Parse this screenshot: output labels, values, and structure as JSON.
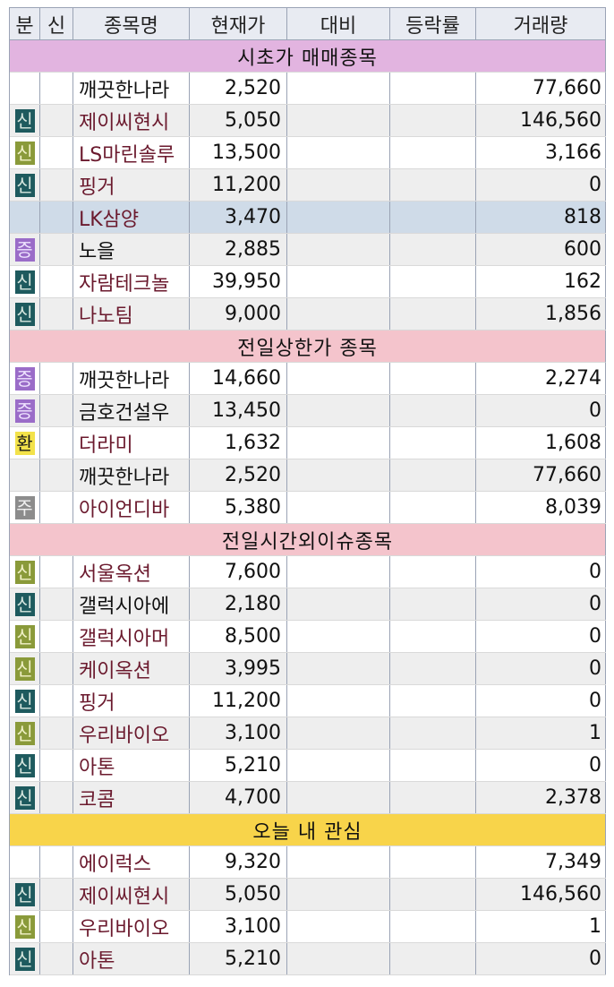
{
  "columns": [
    "분",
    "신",
    "종목명",
    "현재가",
    "대비",
    "등락률",
    "거래량"
  ],
  "badge_styles": {
    "신a": {
      "bg": "#1e5a5e",
      "fg": "#d8e8e0"
    },
    "신b": {
      "bg": "#8a9a3a",
      "fg": "#f2f2c8"
    },
    "증": {
      "bg": "#9a6cc8",
      "fg": "#efe4ff"
    },
    "환": {
      "bg": "#f3e24a",
      "fg": "#1a1a1a"
    },
    "주": {
      "bg": "#8c8c8c",
      "fg": "#f0f0f0"
    }
  },
  "sections": [
    {
      "title": "시초가 매매종목",
      "color": "#e2b4e0",
      "rows": [
        {
          "cat": "",
          "name": "깨끗한나라",
          "name_color": "black",
          "price": "2,520",
          "vol": "77,660"
        },
        {
          "cat": "신",
          "cat_style": "신a",
          "name": "제이씨현시",
          "name_color": "dark",
          "price": "5,050",
          "vol": "146,560"
        },
        {
          "cat": "신",
          "cat_style": "신b",
          "name": "LS마린솔루",
          "name_color": "dark",
          "price": "13,500",
          "vol": "3,166"
        },
        {
          "cat": "신",
          "cat_style": "신a",
          "name": "핑거",
          "name_color": "dark",
          "price": "11,200",
          "vol": "0"
        },
        {
          "cat": "",
          "name": "LK삼양",
          "name_color": "dark",
          "price": "3,470",
          "vol": "818",
          "selected": true
        },
        {
          "cat": "증",
          "cat_style": "증",
          "name": "노을",
          "name_color": "black",
          "price": "2,885",
          "vol": "600"
        },
        {
          "cat": "신",
          "cat_style": "신a",
          "name": "자람테크놀",
          "name_color": "dark",
          "price": "39,950",
          "vol": "162"
        },
        {
          "cat": "신",
          "cat_style": "신a",
          "name": "나노팀",
          "name_color": "dark",
          "price": "9,000",
          "vol": "1,856"
        }
      ]
    },
    {
      "title": "전일상한가 종목",
      "color": "#f4c4cc",
      "rows": [
        {
          "cat": "증",
          "cat_style": "증",
          "name": "깨끗한나라",
          "name_color": "black",
          "price": "14,660",
          "vol": "2,274"
        },
        {
          "cat": "증",
          "cat_style": "증",
          "name": "금호건설우",
          "name_color": "black",
          "price": "13,450",
          "vol": "0"
        },
        {
          "cat": "환",
          "cat_style": "환",
          "name": "더라미",
          "name_color": "dark",
          "price": "1,632",
          "vol": "1,608"
        },
        {
          "cat": "",
          "name": "깨끗한나라",
          "name_color": "black",
          "price": "2,520",
          "vol": "77,660"
        },
        {
          "cat": "주",
          "cat_style": "주",
          "name": "아이언디바",
          "name_color": "dark",
          "price": "5,380",
          "vol": "8,039"
        }
      ]
    },
    {
      "title": "전일시간외이슈종목",
      "color": "#f4c4cc",
      "rows": [
        {
          "cat": "신",
          "cat_style": "신b",
          "name": "서울옥션",
          "name_color": "dark",
          "price": "7,600",
          "vol": "0"
        },
        {
          "cat": "신",
          "cat_style": "신a",
          "name": "갤럭시아에",
          "name_color": "black",
          "price": "2,180",
          "vol": "0"
        },
        {
          "cat": "신",
          "cat_style": "신b",
          "name": "갤럭시아머",
          "name_color": "dark",
          "price": "8,500",
          "vol": "0"
        },
        {
          "cat": "신",
          "cat_style": "신b",
          "name": "케이옥션",
          "name_color": "dark",
          "price": "3,995",
          "vol": "0"
        },
        {
          "cat": "신",
          "cat_style": "신a",
          "name": "핑거",
          "name_color": "dark",
          "price": "11,200",
          "vol": "0"
        },
        {
          "cat": "신",
          "cat_style": "신b",
          "name": "우리바이오",
          "name_color": "dark",
          "price": "3,100",
          "vol": "1"
        },
        {
          "cat": "신",
          "cat_style": "신a",
          "name": "아톤",
          "name_color": "dark",
          "price": "5,210",
          "vol": "0"
        },
        {
          "cat": "신",
          "cat_style": "신a",
          "name": "코콤",
          "name_color": "dark",
          "price": "4,700",
          "vol": "2,378"
        }
      ]
    },
    {
      "title": "오늘 내 관심",
      "color": "#f8d44a",
      "rows": [
        {
          "cat": "",
          "name": "에이럭스",
          "name_color": "dark",
          "price": "9,320",
          "vol": "7,349"
        },
        {
          "cat": "신",
          "cat_style": "신a",
          "name": "제이씨현시",
          "name_color": "dark",
          "price": "5,050",
          "vol": "146,560"
        },
        {
          "cat": "신",
          "cat_style": "신b",
          "name": "우리바이오",
          "name_color": "dark",
          "price": "3,100",
          "vol": "1"
        },
        {
          "cat": "신",
          "cat_style": "신a",
          "name": "아톤",
          "name_color": "dark",
          "price": "5,210",
          "vol": "0"
        }
      ]
    }
  ]
}
